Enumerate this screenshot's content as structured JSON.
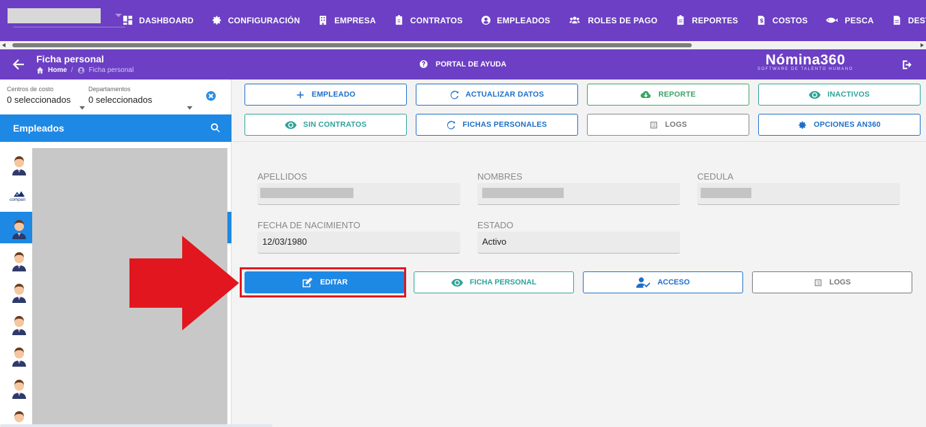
{
  "topnav": {
    "items": [
      {
        "label": "DASHBOARD",
        "icon": "dashboard-icon"
      },
      {
        "label": "CONFIGURACIÓN",
        "icon": "gear-icon"
      },
      {
        "label": "EMPRESA",
        "icon": "building-icon"
      },
      {
        "label": "CONTRATOS",
        "icon": "clipboard-icon"
      },
      {
        "label": "EMPLEADOS",
        "icon": "user-circle-icon"
      },
      {
        "label": "ROLES DE PAGO",
        "icon": "users-icon"
      },
      {
        "label": "REPORTES",
        "icon": "clipboard-list-icon"
      },
      {
        "label": "COSTOS",
        "icon": "file-dollar-icon"
      },
      {
        "label": "PESCA",
        "icon": "fish-icon"
      },
      {
        "label": "DESTAJO",
        "icon": "file-icon"
      }
    ]
  },
  "header": {
    "title": "Ficha personal",
    "breadcrumb_home": "Home",
    "breadcrumb_sep": "/",
    "breadcrumb_current": "Ficha personal",
    "help_label": "PORTAL DE AYUDA",
    "brand_name": "Nómina360",
    "brand_tagline": "SOFTWARE DE TALENTO HUMANO"
  },
  "filters": {
    "cost_centers_label": "Centros de costo",
    "cost_centers_value": "0 seleccionados",
    "departments_label": "Departamentos",
    "departments_value": "0 seleccionados"
  },
  "employees_panel": {
    "title": "Empleados",
    "selected_index": 2
  },
  "actions": {
    "row1": [
      {
        "label": "EMPLEADO",
        "icon": "plus-icon",
        "style": "blue"
      },
      {
        "label": "ACTUALIZAR DATOS",
        "icon": "refresh-icon",
        "style": "blue"
      },
      {
        "label": "REPORTE",
        "icon": "cloud-download-icon",
        "style": "green"
      },
      {
        "label": "INACTIVOS",
        "icon": "eye-icon",
        "style": "teal"
      }
    ],
    "row2": [
      {
        "label": "SIN CONTRATOS",
        "icon": "eye-icon",
        "style": "teal"
      },
      {
        "label": "FICHAS PERSONALES",
        "icon": "refresh-icon",
        "style": "blue"
      },
      {
        "label": "LOGS",
        "icon": "list-icon",
        "style": "grey"
      },
      {
        "label": "OPCIONES AN360",
        "icon": "gear-icon",
        "style": "blue"
      }
    ]
  },
  "form": {
    "apellidos_label": "APELLIDOS",
    "nombres_label": "NOMBRES",
    "cedula_label": "CEDULA",
    "fecha_label": "FECHA DE NACIMIENTO",
    "fecha_value": "12/03/1980",
    "estado_label": "ESTADO",
    "estado_value": "Activo"
  },
  "bottom_buttons": {
    "editar": "EDITAR",
    "ficha": "FICHA PERSONAL",
    "acceso": "ACCESO",
    "logs": "LOGS"
  },
  "colors": {
    "primary_purple": "#6c3fc4",
    "accent_blue": "#1e88e5",
    "highlight_red": "#e2161e"
  }
}
